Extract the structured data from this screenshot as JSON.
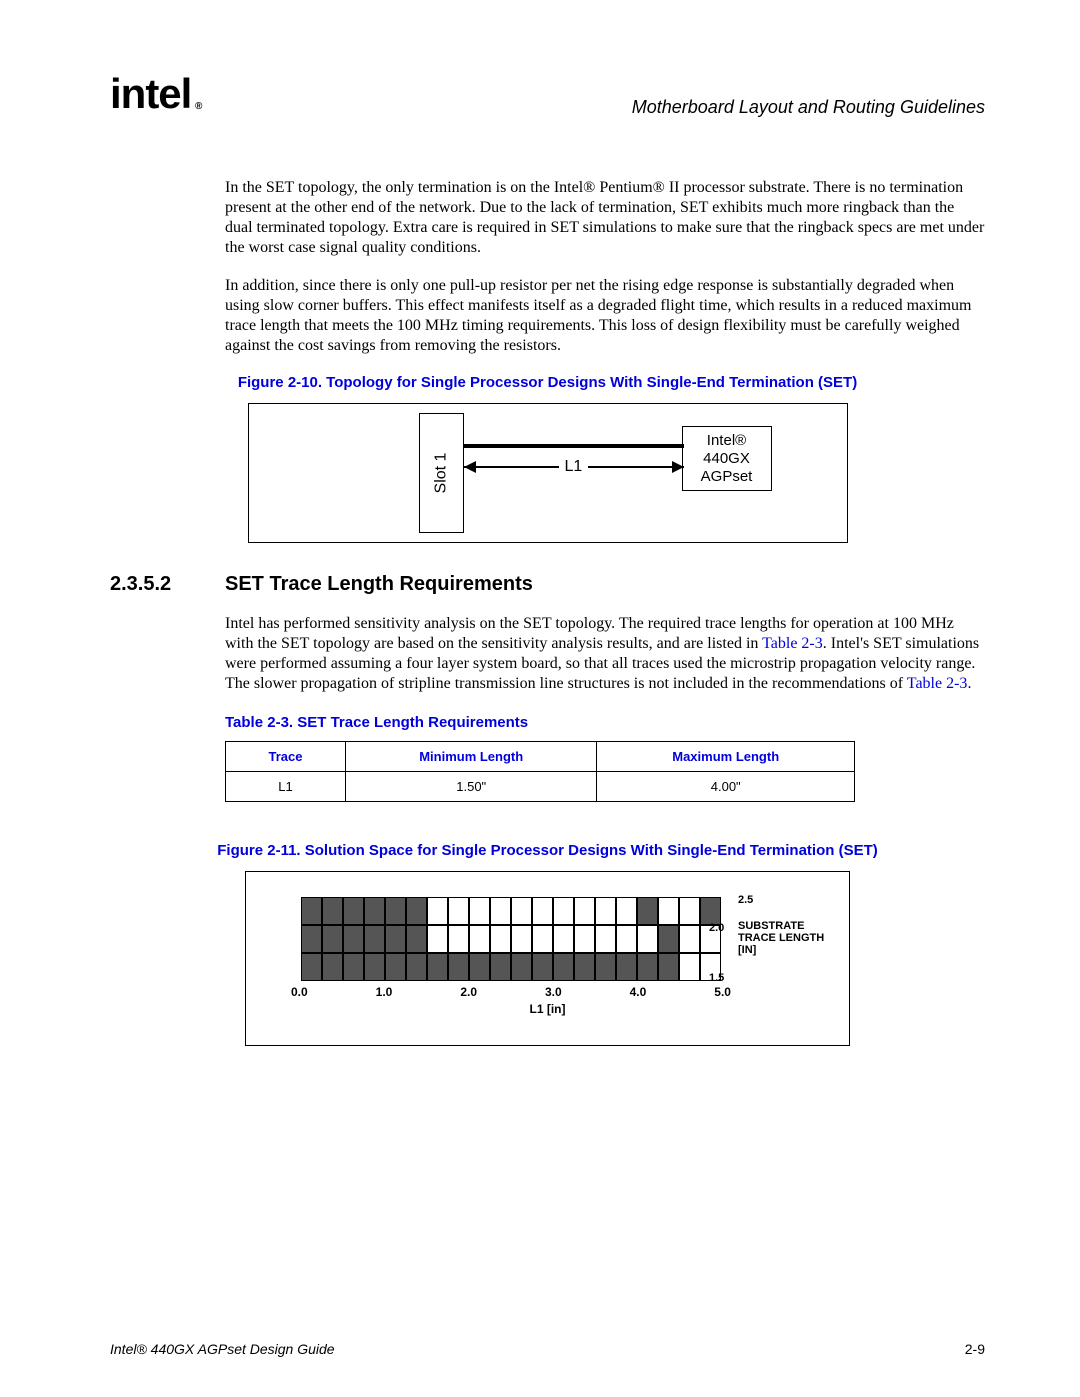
{
  "header": {
    "logo": "intel",
    "section": "Motherboard Layout and Routing Guidelines"
  },
  "para1": "In the SET topology, the only termination is on the Intel® Pentium® II processor substrate. There is no termination present at the other end of the network. Due to the lack of termination, SET exhibits much more ringback than the dual terminated topology. Extra care is required in SET simulations to make sure that the ringback specs are met under the worst case signal quality conditions.",
  "para2": "In addition, since there is only one pull-up resistor per net the rising edge response is substantially degraded when using slow corner buffers. This effect manifests itself as a degraded flight time, which results in a reduced maximum trace length that meets the 100 MHz timing requirements. This loss of design flexibility must be carefully weighed against the cost savings from removing the resistors.",
  "fig10_caption": "Figure 2-10. Topology for Single Processor Designs With Single-End Termination (SET)",
  "diagram": {
    "slot": "Slot 1",
    "l1": "L1",
    "chip_line1": "Intel®",
    "chip_line2": "440GX",
    "chip_line3": "AGPset"
  },
  "heading": {
    "num": "2.3.5.2",
    "text": "SET Trace Length Requirements"
  },
  "para3_a": "Intel has performed sensitivity analysis on the SET topology. The required trace lengths for operation at 100 MHz with the SET topology are based on the sensitivity analysis results, and are listed in ",
  "para3_link1": "Table 2-3",
  "para3_b": ". Intel's SET simulations were performed assuming a four layer system board, so that all traces used the microstrip propagation velocity range. The slower propagation of stripline transmission line structures is not included in the recommendations of ",
  "para3_link2": "Table 2-3",
  "para3_c": ".",
  "table_caption": "Table 2-3. SET Trace Length Requirements",
  "table": {
    "headers": [
      "Trace",
      "Minimum Length",
      "Maximum Length"
    ],
    "row": [
      "L1",
      "1.50\"",
      "4.00\""
    ]
  },
  "fig11_caption": "Figure 2-11. Solution Space for Single Processor Designs With Single-End Termination (SET)",
  "chart_data": {
    "type": "heatmap",
    "title": "",
    "xlabel": "L1 [in]",
    "ylabel": "SUBSTRATE TRACE LENGTH [IN]",
    "x_ticks": [
      "0.0",
      "1.0",
      "2.0",
      "3.0",
      "4.0",
      "5.0"
    ],
    "y_ticks": [
      "1.5",
      "2.0",
      "2.5"
    ],
    "x_range": [
      0.0,
      5.0
    ],
    "y_range": [
      1.5,
      2.5
    ],
    "x_step": 0.25,
    "y_step": 0.5,
    "filled_cells_description": "Shaded region covers: full columns x=0.0-1.5 for all y; at y=2.0-2.5 extends to x~4.0-4.25; at y=1.5-2.0 extends to x~4.25-4.5; also column x~4.75-5.0 at y=2.0-2.5 shaded. Unshaded (solution) region roughly x=1.5 to 4.0 across y.",
    "grid": [
      [
        1,
        1,
        1,
        1,
        1,
        1,
        0,
        0,
        0,
        0,
        0,
        0,
        0,
        0,
        0,
        0,
        1,
        0,
        0,
        1
      ],
      [
        1,
        1,
        1,
        1,
        1,
        1,
        0,
        0,
        0,
        0,
        0,
        0,
        0,
        0,
        0,
        0,
        0,
        1,
        0,
        0
      ],
      [
        1,
        1,
        1,
        1,
        1,
        1,
        1,
        1,
        1,
        1,
        1,
        1,
        1,
        1,
        1,
        1,
        1,
        1,
        0,
        0
      ]
    ]
  },
  "footer": {
    "left": "Intel® 440GX AGPset Design Guide",
    "right": "2-9"
  }
}
